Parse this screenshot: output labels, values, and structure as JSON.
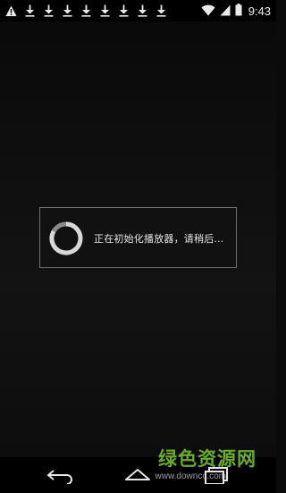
{
  "status_bar": {
    "time": "9:43",
    "notification_icons": [
      "warning-icon",
      "download-icon",
      "download-icon",
      "download-icon",
      "download-icon",
      "download-icon",
      "download-icon",
      "download-icon",
      "download-icon"
    ],
    "indicators": [
      "wifi-icon",
      "signal-icon",
      "battery-icon"
    ]
  },
  "dialog": {
    "message": "正在初始化播放器，请稍后..."
  },
  "nav_bar": {
    "buttons": [
      "back-icon",
      "home-icon",
      "recents-icon"
    ]
  },
  "watermark": {
    "text": "绿色资源网",
    "url": "www.downcc.com"
  }
}
